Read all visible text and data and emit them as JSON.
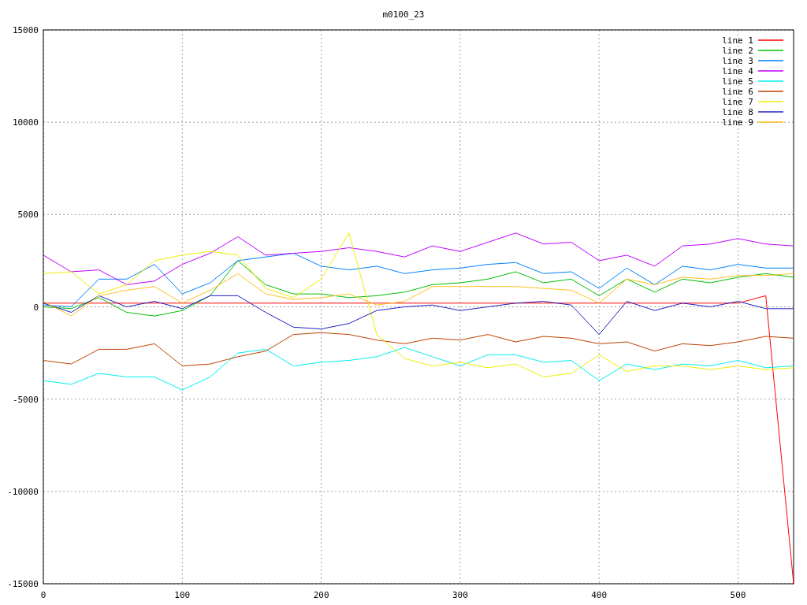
{
  "chart": {
    "chart_data": {
      "type": "line",
      "title": "m0100_23",
      "x": [
        0,
        20,
        40,
        60,
        80,
        100,
        120,
        140,
        160,
        180,
        200,
        220,
        240,
        260,
        280,
        300,
        320,
        340,
        360,
        380,
        400,
        420,
        440,
        460,
        480,
        500,
        520,
        540
      ],
      "grid": true,
      "legend": true,
      "xlim": [
        0,
        540
      ],
      "ylim": [
        -15000,
        15000
      ],
      "xticks": [
        0,
        100,
        200,
        300,
        400,
        500
      ],
      "yticks": [
        -15000,
        -10000,
        -5000,
        0,
        5000,
        10000,
        15000
      ],
      "series": [
        {
          "name": "line 1",
          "color": "#ff0000",
          "values": [
            200,
            200,
            200,
            200,
            200,
            200,
            200,
            200,
            200,
            200,
            200,
            200,
            200,
            200,
            200,
            200,
            200,
            200,
            200,
            200,
            200,
            200,
            200,
            200,
            200,
            200,
            600,
            -15000
          ]
        },
        {
          "name": "line 2",
          "color": "#00c000",
          "values": [
            0,
            -100,
            500,
            -300,
            -500,
            -200,
            600,
            2500,
            1200,
            700,
            700,
            500,
            600,
            800,
            1200,
            1300,
            1500,
            1900,
            1300,
            1500,
            600,
            1500,
            800,
            1500,
            1300,
            1600,
            1800,
            1600
          ]
        },
        {
          "name": "line 3",
          "color": "#0080ff",
          "values": [
            100,
            0,
            1500,
            1500,
            2300,
            700,
            1300,
            2500,
            2700,
            2900,
            2200,
            2000,
            2200,
            1800,
            2000,
            2100,
            2300,
            2400,
            1800,
            1900,
            1000,
            2100,
            1200,
            2200,
            2000,
            2300,
            2100,
            2100
          ]
        },
        {
          "name": "line 4",
          "color": "#c000ff",
          "values": [
            2800,
            1900,
            2000,
            1200,
            1400,
            2300,
            2900,
            3800,
            2800,
            2900,
            3000,
            3200,
            3000,
            2700,
            3300,
            3000,
            3500,
            4000,
            3400,
            3500,
            2500,
            2800,
            2200,
            3300,
            3400,
            3700,
            3400,
            3300
          ]
        },
        {
          "name": "line 5",
          "color": "#00eeee",
          "values": [
            -4000,
            -4200,
            -3600,
            -3800,
            -3800,
            -4500,
            -3800,
            -2500,
            -2300,
            -3200,
            -3000,
            -2900,
            -2700,
            -2200,
            -2700,
            -3200,
            -2600,
            -2600,
            -3000,
            -2900,
            -4000,
            -3100,
            -3400,
            -3100,
            -3200,
            -2900,
            -3300,
            -3200
          ]
        },
        {
          "name": "line 6",
          "color": "#c04000",
          "values": [
            -2900,
            -3100,
            -2300,
            -2300,
            -2000,
            -3200,
            -3100,
            -2700,
            -2400,
            -1500,
            -1400,
            -1500,
            -1800,
            -2000,
            -1700,
            -1800,
            -1500,
            -1900,
            -1600,
            -1700,
            -2000,
            -1900,
            -2400,
            -2000,
            -2100,
            -1900,
            -1600,
            -1700
          ]
        },
        {
          "name": "line 7",
          "color": "#eeee00",
          "values": [
            1800,
            1900,
            700,
            1200,
            2500,
            2800,
            3000,
            2800,
            1000,
            500,
            1500,
            4000,
            -1500,
            -2800,
            -3200,
            -3000,
            -3300,
            -3100,
            -3800,
            -3600,
            -2600,
            -3500,
            -3200,
            -3200,
            -3400,
            -3200,
            -3400,
            -3300
          ]
        },
        {
          "name": "line 8",
          "color": "#2020c0",
          "values": [
            200,
            -300,
            600,
            0,
            300,
            -100,
            600,
            600,
            -300,
            -1100,
            -1200,
            -900,
            -200,
            0,
            100,
            -200,
            0,
            200,
            300,
            100,
            -1500,
            300,
            -200,
            200,
            0,
            300,
            -100,
            -100
          ]
        },
        {
          "name": "line 9",
          "color": "#ffc020",
          "values": [
            300,
            -500,
            600,
            900,
            1100,
            200,
            900,
            1800,
            700,
            400,
            500,
            700,
            100,
            300,
            1100,
            1100,
            1100,
            1100,
            1000,
            900,
            200,
            1500,
            1200,
            1600,
            1500,
            1700,
            1700,
            1800
          ]
        }
      ]
    }
  }
}
